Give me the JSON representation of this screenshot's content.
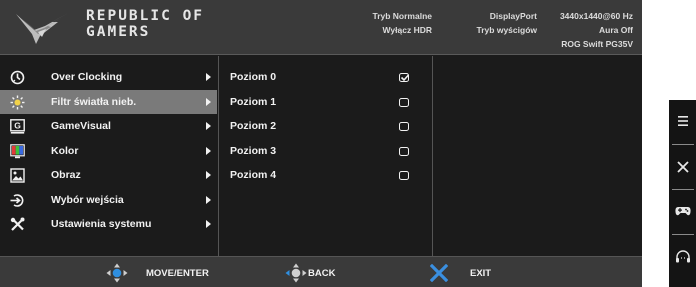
{
  "header": {
    "brand_line1": "REPUBLIC OF",
    "brand_line2": "GAMERS",
    "mode": "Tryb Normalne",
    "hdr": "Wyłącz HDR",
    "input": "DisplayPort",
    "racing": "Tryb wyścigów",
    "resolution": "3440x1440@60 Hz",
    "aura": "Aura Off",
    "model": "ROG Swift PG35V"
  },
  "menu": [
    {
      "label": "Over Clocking",
      "icon": "clock-icon"
    },
    {
      "label": "Filtr światła nieb.",
      "icon": "blue-light-icon",
      "selected": true
    },
    {
      "label": "GameVisual",
      "icon": "gamevisual-icon"
    },
    {
      "label": "Kolor",
      "icon": "color-icon"
    },
    {
      "label": "Obraz",
      "icon": "image-icon"
    },
    {
      "label": "Wybór wejścia",
      "icon": "input-select-icon"
    },
    {
      "label": "Ustawienia systemu",
      "icon": "tools-icon"
    }
  ],
  "options": [
    {
      "label": "Poziom 0",
      "checked": true
    },
    {
      "label": "Poziom 1",
      "checked": false
    },
    {
      "label": "Poziom 2",
      "checked": false
    },
    {
      "label": "Poziom 3",
      "checked": false
    },
    {
      "label": "Poziom 4",
      "checked": false
    }
  ],
  "footer": {
    "move_enter": "MOVE/ENTER",
    "back": "BACK",
    "exit": "EXIT"
  },
  "colors": {
    "osd_bg": "#1b1b1b",
    "header_bg": "#3a3a3a",
    "selected_bg": "#7a7a7a",
    "joystick_blue": "#2f8fe0",
    "exit_x_blue": "#3a8fe0"
  },
  "side_toolbar": [
    "menu-icon",
    "close-icon",
    "gamepad-icon",
    "headphones-icon"
  ]
}
